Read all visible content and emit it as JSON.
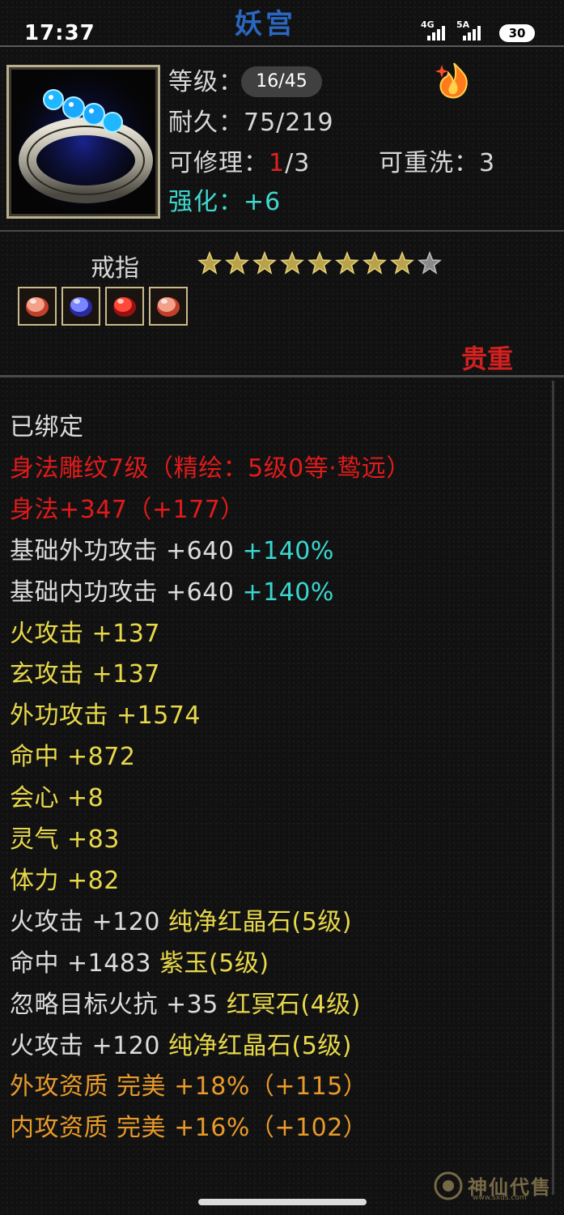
{
  "status_bar": {
    "time": "17:37",
    "network1": "4G",
    "network2": "5A",
    "battery": "30"
  },
  "item": {
    "title": "妖宫",
    "level_label": "等级：",
    "durability_label": "耐久：",
    "durability_value": "75/219",
    "repair_label": "可修理：",
    "repair_used": "1",
    "repair_total": "/3",
    "rewash_label": "可重洗：",
    "rewash_value": "3",
    "enhance_label": "强化：",
    "enhance_value": "+6",
    "type": "戒指",
    "stars_filled": 8,
    "stars_total": 9,
    "quality": "贵重"
  },
  "viewer": {
    "page_indicator": "16/45"
  },
  "properties": [
    {
      "parts": [
        {
          "text": "已绑定",
          "color": "white"
        }
      ]
    },
    {
      "parts": [
        {
          "text": "身法雕纹7级（精绘：5级0等·鸷远）",
          "color": "red"
        }
      ]
    },
    {
      "parts": [
        {
          "text": "身法+347（+177）",
          "color": "red"
        }
      ]
    },
    {
      "parts": [
        {
          "text": "基础外功攻击 +640 ",
          "color": "white"
        },
        {
          "text": "+140%",
          "color": "cyan"
        }
      ]
    },
    {
      "parts": [
        {
          "text": "基础内功攻击 +640 ",
          "color": "white"
        },
        {
          "text": "+140%",
          "color": "cyan"
        }
      ]
    },
    {
      "parts": [
        {
          "text": "火攻击 +137",
          "color": "yellow"
        }
      ]
    },
    {
      "parts": [
        {
          "text": "玄攻击 +137",
          "color": "yellow"
        }
      ]
    },
    {
      "parts": [
        {
          "text": "外功攻击 +1574",
          "color": "yellow"
        }
      ]
    },
    {
      "parts": [
        {
          "text": "命中 +872",
          "color": "yellow"
        }
      ]
    },
    {
      "parts": [
        {
          "text": "会心 +8",
          "color": "yellow"
        }
      ]
    },
    {
      "parts": [
        {
          "text": "灵气 +83",
          "color": "yellow"
        }
      ]
    },
    {
      "parts": [
        {
          "text": "体力 +82",
          "color": "yellow"
        }
      ]
    },
    {
      "parts": [
        {
          "text": "火攻击 +120 ",
          "color": "white"
        },
        {
          "text": "纯净红晶石(5级)",
          "color": "yellow"
        }
      ]
    },
    {
      "parts": [
        {
          "text": "命中 +1483 ",
          "color": "white"
        },
        {
          "text": "紫玉(5级)",
          "color": "yellow"
        }
      ]
    },
    {
      "parts": [
        {
          "text": "忽略目标火抗 +35 ",
          "color": "white"
        },
        {
          "text": "红冥石(4级)",
          "color": "yellow"
        }
      ]
    },
    {
      "parts": [
        {
          "text": "火攻击 +120 ",
          "color": "white"
        },
        {
          "text": "纯净红晶石(5级)",
          "color": "yellow"
        }
      ]
    },
    {
      "parts": [
        {
          "text": "外攻资质  完美 +18%（+115）",
          "color": "orange"
        }
      ]
    },
    {
      "parts": [
        {
          "text": "内攻资质  完美 +16%（+102）",
          "color": "orange"
        }
      ]
    }
  ],
  "gems": [
    "pink-gem-icon",
    "blue-gem-icon",
    "red-gem-icon",
    "pink-gem-icon"
  ],
  "watermark": {
    "text": "神仙代售",
    "url": "www.sxds.com"
  },
  "colors": {
    "white": "#dcdcdc",
    "red": "#e01b1b",
    "yellow": "#e8d84a",
    "orange": "#e89a2a",
    "cyan": "#38d6d0"
  }
}
